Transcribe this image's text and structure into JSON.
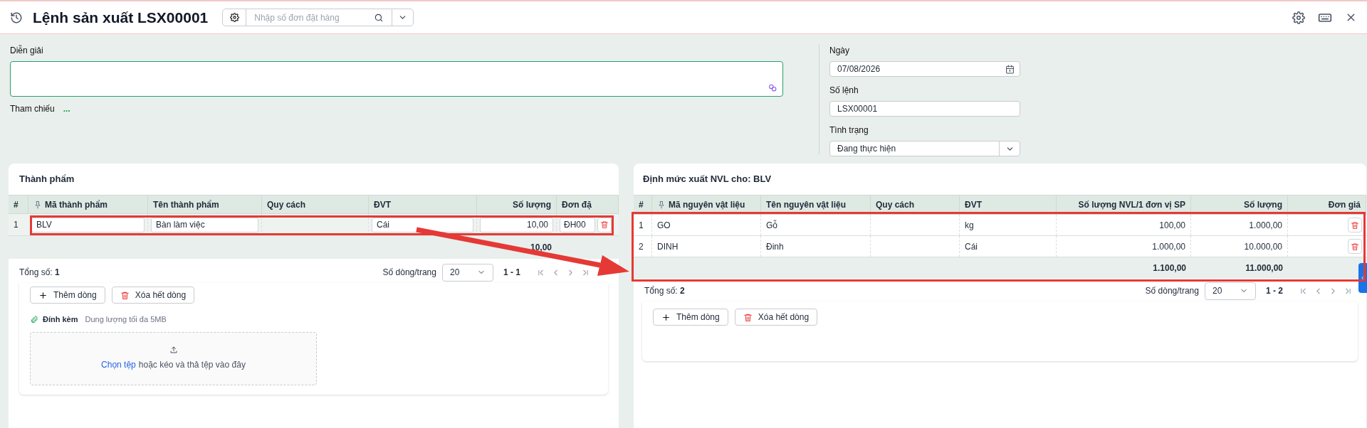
{
  "header": {
    "title": "Lệnh sản xuất LSX00001",
    "search": {
      "placeholder": "Nhập số đơn đặt hàng"
    }
  },
  "form": {
    "description": {
      "label": "Diễn giải"
    },
    "reference": {
      "label": "Tham chiếu",
      "link": "..."
    },
    "date": {
      "label": "Ngày",
      "value": "07/08/2026"
    },
    "order_no": {
      "label": "Số lệnh",
      "value": "LSX00001"
    },
    "status": {
      "label": "Tình trạng",
      "value": "Đang thực hiện"
    }
  },
  "products": {
    "title": "Thành phẩm",
    "columns": [
      "#",
      "Mã thành phẩm",
      "Tên thành phẩm",
      "Quy cách",
      "ĐVT",
      "Số lượng",
      "Đơn đặ"
    ],
    "rows": [
      {
        "index": "1",
        "code": "BLV",
        "name": "Bàn làm việc",
        "unit": "Cái",
        "quantity": "10,00",
        "order": "ĐH00"
      }
    ],
    "totals": {
      "quantity": "10,00"
    },
    "footer": {
      "count": "Tổng số: **1**",
      "page_size_label": "Số dòng/trang",
      "page_size": "20",
      "range": "1 - 1"
    },
    "buttons": {
      "add": "Thêm dòng",
      "clear": "Xóa hết dòng"
    },
    "attachment": {
      "label": "Đính kèm",
      "hint": "Dung lượng tối đa 5MB",
      "link": "Chọn tệp",
      "text": "hoặc kéo và thả tệp vào đây"
    }
  },
  "materials": {
    "title": "Định mức xuất NVL cho: BLV",
    "columns": [
      "#",
      "Mã nguyên vật liệu",
      "Tên nguyên vật liệu",
      "Quy cách",
      "ĐVT",
      "Số lượng NVL/1 đơn vị SP",
      "Số lượng",
      "Đơn giá"
    ],
    "rows": [
      {
        "index": "1",
        "code": "GO",
        "name": "Gỗ",
        "unit": "kg",
        "per_unit": "100,00",
        "quantity": "1.000,00"
      },
      {
        "index": "2",
        "code": "DINH",
        "name": "Đinh",
        "unit": "Cái",
        "per_unit": "1.000,00",
        "quantity": "10.000,00"
      }
    ],
    "totals": {
      "per_unit": "1.100,00",
      "quantity": "11.000,00"
    },
    "footer": {
      "count": "Tổng số: **2**",
      "page_size_label": "Số dòng/trang",
      "page_size": "20",
      "range": "1 - 2"
    },
    "buttons": {
      "add": "Thêm dòng",
      "clear": "Xóa hết dòng"
    }
  },
  "annotations": [
    {
      "kind": "row_box"
    },
    {
      "kind": "table_box"
    },
    {
      "kind": "arrow"
    }
  ]
}
